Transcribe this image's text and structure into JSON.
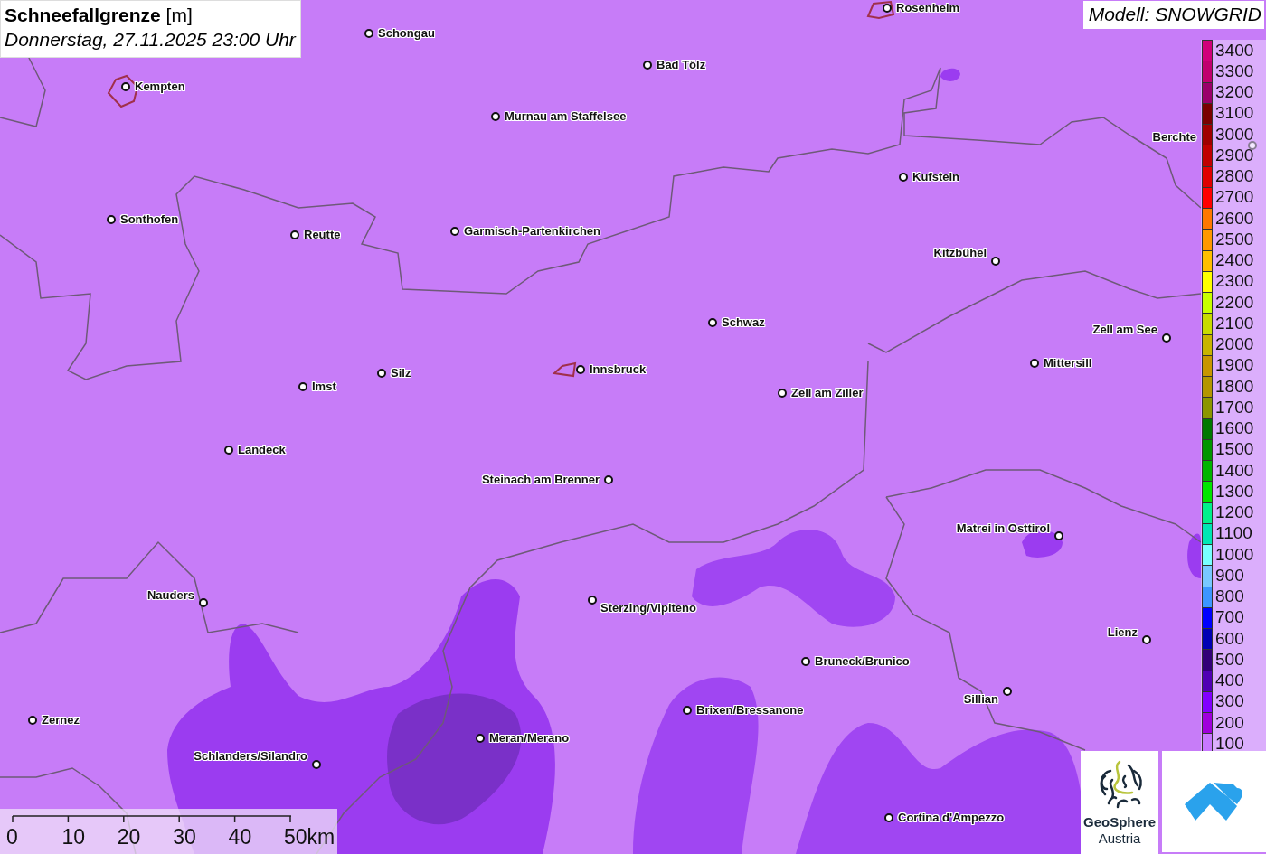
{
  "title": {
    "heading": "**Schneefallgrenze** [m]",
    "datetime": "Donnerstag, 27.11.2025 23:00 Uhr"
  },
  "model": "Modell: SNOWGRID",
  "cities": [
    {
      "name": "Schongau"
    },
    {
      "name": "Rosenheim"
    },
    {
      "name": "Kempten"
    },
    {
      "name": "Bad Tölz"
    },
    {
      "name": "Murnau am Staffelsee"
    },
    {
      "name": "Berchte"
    },
    {
      "name": "Kufstein"
    },
    {
      "name": "Sonthofen"
    },
    {
      "name": "Reutte"
    },
    {
      "name": "Garmisch-Partenkirchen"
    },
    {
      "name": "Kitzbühel"
    },
    {
      "name": "Schwaz"
    },
    {
      "name": "Zell am See"
    },
    {
      "name": "Mittersill"
    },
    {
      "name": "Silz"
    },
    {
      "name": "Innsbruck"
    },
    {
      "name": "Imst"
    },
    {
      "name": "Zell am Ziller"
    },
    {
      "name": "Landeck"
    },
    {
      "name": "Steinach am Brenner"
    },
    {
      "name": "Matrei in Osttirol"
    },
    {
      "name": "Nauders"
    },
    {
      "name": "Sterzing/Vipiteno"
    },
    {
      "name": "Lienz"
    },
    {
      "name": "Bruneck/Brunico"
    },
    {
      "name": "Sillian"
    },
    {
      "name": "Brixen/Bressanone"
    },
    {
      "name": "Zernez"
    },
    {
      "name": "Meran/Merano"
    },
    {
      "name": "Schlanders/Silandro"
    },
    {
      "name": "Cortina d'Ampezzo"
    }
  ],
  "legend": [
    {
      "label": "3400",
      "color": "#d0007a"
    },
    {
      "label": "3300",
      "color": "#c0006e"
    },
    {
      "label": "3200",
      "color": "#9a006a"
    },
    {
      "label": "3100",
      "color": "#7a0000"
    },
    {
      "label": "3000",
      "color": "#a00000"
    },
    {
      "label": "2900",
      "color": "#c00000"
    },
    {
      "label": "2800",
      "color": "#e00000"
    },
    {
      "label": "2700",
      "color": "#ff0000"
    },
    {
      "label": "2600",
      "color": "#ff7800"
    },
    {
      "label": "2500",
      "color": "#ff9800"
    },
    {
      "label": "2400",
      "color": "#ffbe00"
    },
    {
      "label": "2300",
      "color": "#ffff00"
    },
    {
      "label": "2200",
      "color": "#c8ff00"
    },
    {
      "label": "2100",
      "color": "#c8dc00"
    },
    {
      "label": "2000",
      "color": "#c8b400"
    },
    {
      "label": "1900",
      "color": "#c89600"
    },
    {
      "label": "1800",
      "color": "#b49600"
    },
    {
      "label": "1700",
      "color": "#8c9600"
    },
    {
      "label": "1600",
      "color": "#007800"
    },
    {
      "label": "1500",
      "color": "#009600"
    },
    {
      "label": "1400",
      "color": "#00b400"
    },
    {
      "label": "1300",
      "color": "#00e600"
    },
    {
      "label": "1200",
      "color": "#00f08c"
    },
    {
      "label": "1100",
      "color": "#00e6b4"
    },
    {
      "label": "1000",
      "color": "#78ffff"
    },
    {
      "label": "900",
      "color": "#78c8ff"
    },
    {
      "label": "800",
      "color": "#3c96ff"
    },
    {
      "label": "700",
      "color": "#0000ff"
    },
    {
      "label": "600",
      "color": "#0000b4"
    },
    {
      "label": "500",
      "color": "#320078"
    },
    {
      "label": "400",
      "color": "#5000b4"
    },
    {
      "label": "300",
      "color": "#8200ff"
    },
    {
      "label": "200",
      "color": "#a000dc"
    },
    {
      "label": "100",
      "color": "#c878ff"
    }
  ],
  "scale": {
    "ticks": [
      "0",
      "10",
      "20",
      "30",
      "40",
      "50km"
    ]
  },
  "logos": [
    {
      "kind": "geosphere",
      "lines": [
        "GeoSphere",
        "Austria"
      ]
    },
    {
      "kind": "snow"
    }
  ]
}
